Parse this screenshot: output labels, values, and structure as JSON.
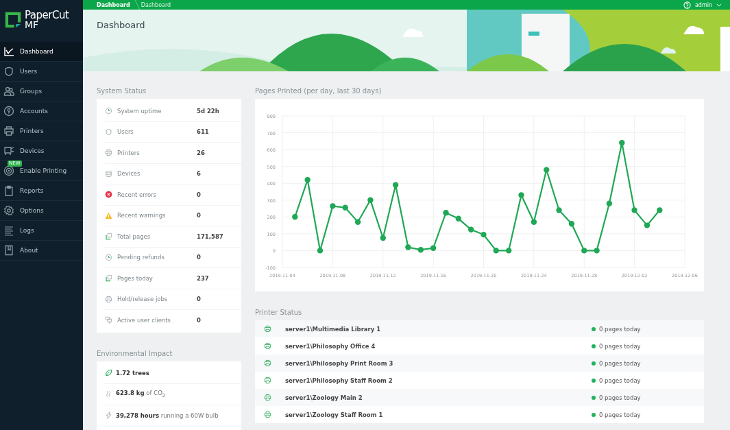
{
  "logo": {
    "name": "PaperCut",
    "edition": "MF"
  },
  "sidebar": {
    "items": [
      {
        "label": "Dashboard",
        "kind": "chart",
        "selected": true
      },
      {
        "label": "Users",
        "kind": "user",
        "selected": false
      },
      {
        "label": "Groups",
        "kind": "group",
        "selected": false
      },
      {
        "label": "Accounts",
        "kind": "account",
        "selected": false
      },
      {
        "label": "Printers",
        "kind": "printer",
        "selected": false
      },
      {
        "label": "Devices",
        "kind": "device",
        "selected": false
      },
      {
        "label": "Enable Printing",
        "kind": "target",
        "selected": false,
        "badge": "NEW"
      },
      {
        "label": "Reports",
        "kind": "clipboard",
        "selected": false
      },
      {
        "label": "Options",
        "kind": "gear",
        "selected": false
      },
      {
        "label": "Logs",
        "kind": "lines",
        "selected": false
      },
      {
        "label": "About",
        "kind": "book",
        "selected": false
      }
    ]
  },
  "breadcrumbs": [
    "Dashboard",
    "Dashboard"
  ],
  "user_menu": {
    "label": "admin"
  },
  "page_title": "Dashboard",
  "system_status": {
    "title": "System Status",
    "rows": [
      {
        "kind": "clock",
        "label": "System uptime",
        "value": "5d 22h"
      },
      {
        "kind": "user",
        "label": "Users",
        "value": "611"
      },
      {
        "kind": "printer",
        "label": "Printers",
        "value": "26"
      },
      {
        "kind": "database",
        "label": "Devices",
        "value": "6"
      },
      {
        "kind": "error",
        "label": "Recent errors",
        "value": "0"
      },
      {
        "kind": "warning",
        "label": "Recent warnings",
        "value": "0"
      },
      {
        "kind": "pages",
        "label": "Total pages",
        "value": "171,587"
      },
      {
        "kind": "clock",
        "label": "Pending refunds",
        "value": "0"
      },
      {
        "kind": "pages",
        "label": "Pages today",
        "value": "237"
      },
      {
        "kind": "printer",
        "label": "Hold/release jobs",
        "value": "0"
      },
      {
        "kind": "clients",
        "label": "Active user clients",
        "value": "0"
      }
    ]
  },
  "environmental_impact": {
    "title": "Environmental Impact",
    "rows": [
      {
        "kind": "leaf",
        "text": "1.72 trees"
      },
      {
        "kind": "smoke",
        "text": "**623.8 kg** of CO$_{2}$"
      },
      {
        "kind": "bolt",
        "text": "**39,278 hours** running a 60W bulb"
      }
    ]
  },
  "pages_printed": {
    "title": "Pages Printed (per day, last 30 days)",
    "chart_data": {
      "type": "line",
      "x": [
        "2019-11-05",
        "2019-11-06",
        "2019-11-07",
        "2019-11-08",
        "2019-11-09",
        "2019-11-10",
        "2019-11-11",
        "2019-11-12",
        "2019-11-13",
        "2019-11-14",
        "2019-11-15",
        "2019-11-16",
        "2019-11-17",
        "2019-11-18",
        "2019-11-19",
        "2019-11-20",
        "2019-11-21",
        "2019-11-22",
        "2019-11-23",
        "2019-11-24",
        "2019-11-25",
        "2019-11-26",
        "2019-11-27",
        "2019-11-28",
        "2019-11-29",
        "2019-11-30",
        "2019-12-01",
        "2019-12-02",
        "2019-12-03",
        "2019-12-04"
      ],
      "series": [
        {
          "color": "#1fa855",
          "marker": "circle",
          "values": [
            200,
            420,
            0,
            265,
            255,
            170,
            300,
            75,
            390,
            20,
            5,
            15,
            225,
            190,
            125,
            95,
            0,
            0,
            330,
            170,
            480,
            240,
            160,
            0,
            0,
            280,
            640,
            240,
            150,
            240
          ]
        }
      ],
      "xlim": [
        "2019-11-04",
        "2019-12-06"
      ],
      "ylim": [
        -100,
        800
      ],
      "grid": true,
      "yticks": [
        -100,
        0,
        100,
        200,
        300,
        400,
        500,
        600,
        700,
        800
      ],
      "xticks": [
        "2019-11-04",
        "2019-11-08",
        "2019-11-12",
        "2019-11-16",
        "2019-11-20",
        "2019-11-24",
        "2019-11-28",
        "2019-12-02",
        "2019-12-06"
      ]
    }
  },
  "printer_status": {
    "title": "Printer Status",
    "rows": [
      {
        "name": "server1\\Multimedia Library 1",
        "status": "0 pages today",
        "color": "#1fb25a"
      },
      {
        "name": "server1\\Philosophy Office 4",
        "status": "0 pages today",
        "color": "#1fb25a"
      },
      {
        "name": "server1\\Philosophy Print Room 3",
        "status": "0 pages today",
        "color": "#1fb25a"
      },
      {
        "name": "server1\\Philosophy Staff Room 2",
        "status": "0 pages today",
        "color": "#1fb25a"
      },
      {
        "name": "server1\\Zoology Main 2",
        "status": "0 pages today",
        "color": "#1fb25a"
      },
      {
        "name": "server1\\Zoology Staff Room 1",
        "status": "0 pages today",
        "color": "#1fb25a"
      }
    ]
  }
}
